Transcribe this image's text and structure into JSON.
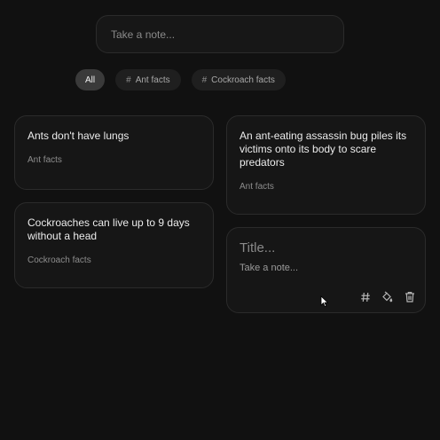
{
  "search": {
    "placeholder": "Take a note..."
  },
  "filters": [
    {
      "label": "All",
      "active": true
    },
    {
      "label": "Ant facts",
      "active": false
    },
    {
      "label": "Cockroach facts",
      "active": false
    }
  ],
  "notes": [
    {
      "title": "Ants don't have lungs",
      "tag": "Ant facts"
    },
    {
      "title": "Cockroaches can live up to 9 days without a head",
      "tag": "Cockroach facts"
    },
    {
      "title": "An ant-eating assassin bug piles its victims onto its body to scare predators",
      "tag": "Ant facts"
    }
  ],
  "editor": {
    "title_placeholder": "Title...",
    "body_placeholder": "Take a note...",
    "actions": [
      "hash-icon",
      "paint-bucket-icon",
      "trash-icon"
    ]
  },
  "colors": {
    "background": "#111111",
    "card": "#161616",
    "border": "#2b2b2b",
    "chip_active": "#3a3a3a"
  }
}
